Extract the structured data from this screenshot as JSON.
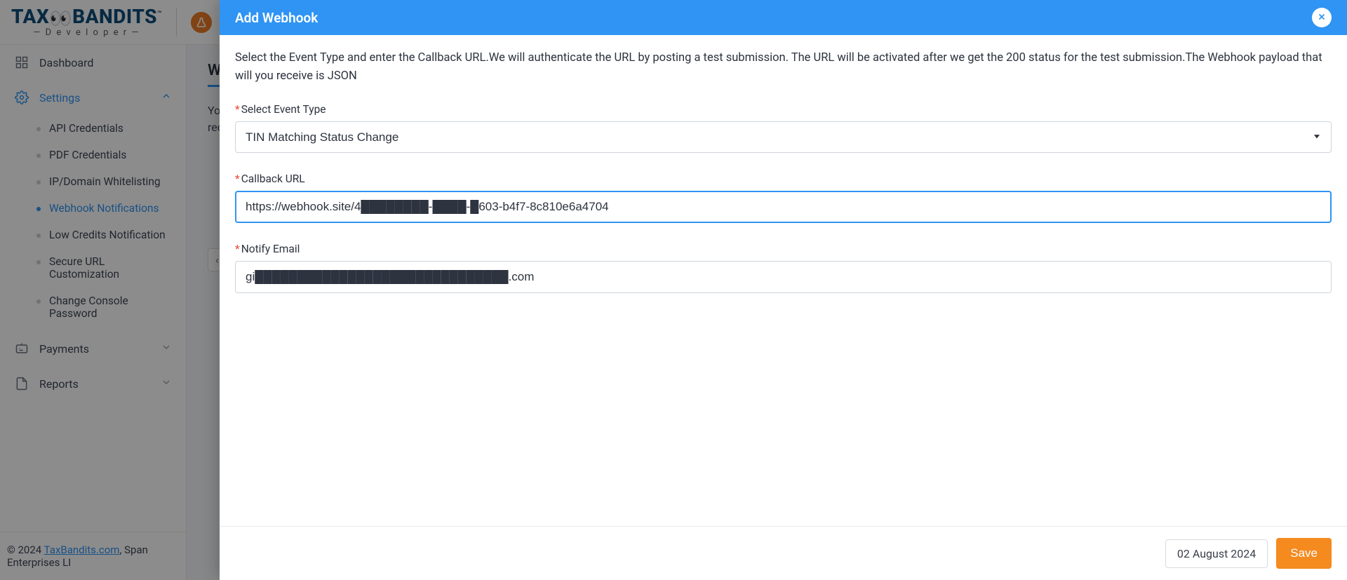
{
  "header": {
    "brand_tax": "TAX",
    "brand_bandits": "BANDITS",
    "brand_dev": "— D e v e l o p e r —",
    "brand_tm": "™"
  },
  "sidebar": {
    "dashboard": "Dashboard",
    "settings": "Settings",
    "payments": "Payments",
    "reports": "Reports",
    "settings_items": [
      {
        "label": "API Credentials"
      },
      {
        "label": "PDF Credentials"
      },
      {
        "label": "IP/Domain Whitelisting"
      },
      {
        "label": "Webhook Notifications"
      },
      {
        "label": "Low Credits Notification"
      },
      {
        "label": "Secure URL Customization"
      },
      {
        "label": "Change Console Password"
      }
    ]
  },
  "page": {
    "title_visible": "We",
    "desc_line1_visible": "You",
    "desc_line2_visible": "rec",
    "pager_prev": "‹"
  },
  "footer": {
    "copyright_prefix": "© 2024 ",
    "link_text": "TaxBandits.com",
    "copyright_suffix": ", Span Enterprises LI"
  },
  "modal": {
    "title": "Add Webhook",
    "intro": "Select the Event Type and enter the Callback URL.We will authenticate the URL by posting a test submission. The URL will be activated after we get the 200 status for the test submission.The Webhook payload that will you receive is JSON",
    "fields": {
      "event_type_label": "Select Event Type",
      "event_type_value": "TIN Matching Status Change",
      "callback_label": "Callback URL",
      "callback_value": "https://webhook.site/4████████-████-█603-b4f7-8c810e6a4704",
      "notify_label": "Notify Email",
      "notify_value": "gi██████████████████████████████.com"
    },
    "date_chip": "02 August 2024",
    "save": "Save"
  }
}
